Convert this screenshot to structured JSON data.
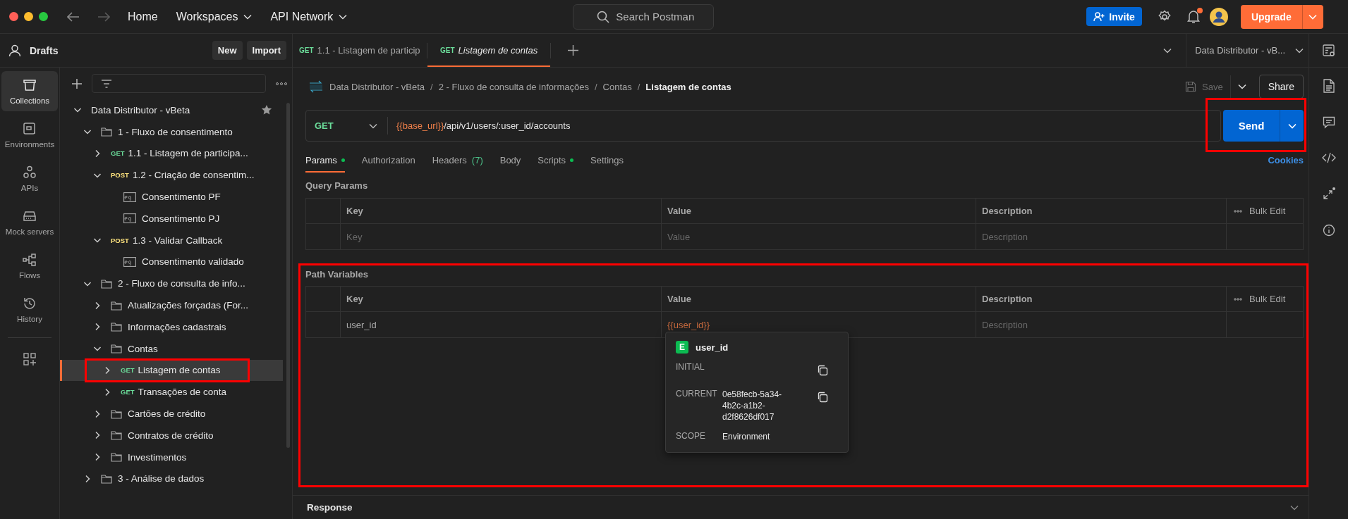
{
  "app_bar": {
    "nav": [
      {
        "label": "Home",
        "dropdown": false
      },
      {
        "label": "Workspaces",
        "dropdown": true
      },
      {
        "label": "API Network",
        "dropdown": true
      }
    ],
    "search": {
      "placeholder": "Search Postman"
    },
    "invite": "Invite",
    "notifications_unread": true,
    "upgrade": "Upgrade"
  },
  "workspace": {
    "title": "Drafts",
    "buttons": [
      "New",
      "Import"
    ]
  },
  "rail": [
    {
      "label": "Collections",
      "kind": "collections",
      "selected": true
    },
    {
      "label": "Environments",
      "kind": "environments",
      "selected": false
    },
    {
      "label": "APIs",
      "kind": "apis",
      "selected": false
    },
    {
      "label": "Mock servers",
      "kind": "mock",
      "selected": false
    },
    {
      "label": "Flows",
      "kind": "flows",
      "selected": false
    },
    {
      "label": "History",
      "kind": "history",
      "selected": false
    }
  ],
  "tree": [
    {
      "kind": "collection",
      "label": "Data Distributor - vBeta",
      "expanded": true,
      "starred": true,
      "selected": false,
      "highlighted": false,
      "children": [
        {
          "kind": "folder",
          "label": "1 - Fluxo de consentimento",
          "expanded": true,
          "selected": false,
          "highlighted": false,
          "children": [
            {
              "kind": "request",
              "method": "GET",
              "color": "#6bdd9a",
              "label": "1.1 - Listagem de participa...",
              "expanded": false,
              "selected": false,
              "highlighted": false
            },
            {
              "kind": "request",
              "method": "POST",
              "color": "#ffe47e",
              "label": "1.2 - Criação de consentim...",
              "expanded": true,
              "selected": false,
              "highlighted": false,
              "children": [
                {
                  "kind": "example",
                  "label": "Consentimento PF",
                  "selected": false,
                  "highlighted": false
                },
                {
                  "kind": "example",
                  "label": "Consentimento PJ",
                  "selected": false,
                  "highlighted": false
                }
              ]
            },
            {
              "kind": "request",
              "method": "POST",
              "color": "#ffe47e",
              "label": "1.3 - Validar Callback",
              "expanded": true,
              "selected": false,
              "highlighted": false,
              "children": [
                {
                  "kind": "example",
                  "label": "Consentimento validado",
                  "selected": false,
                  "highlighted": false
                }
              ]
            }
          ]
        },
        {
          "kind": "folder",
          "label": "2 - Fluxo de consulta de info...",
          "expanded": true,
          "selected": false,
          "highlighted": false,
          "children": [
            {
              "kind": "folder",
              "label": "Atualizações forçadas (For...",
              "expanded": false,
              "selected": false,
              "highlighted": false
            },
            {
              "kind": "folder",
              "label": "Informações cadastrais",
              "expanded": false,
              "selected": false,
              "highlighted": false
            },
            {
              "kind": "folder",
              "label": "Contas",
              "expanded": true,
              "selected": false,
              "highlighted": false,
              "children": [
                {
                  "kind": "request",
                  "method": "GET",
                  "color": "#6bdd9a",
                  "label": "Listagem de contas",
                  "expanded": false,
                  "selected": true,
                  "highlighted": true
                },
                {
                  "kind": "request",
                  "method": "GET",
                  "color": "#6bdd9a",
                  "label": "Transações de conta",
                  "expanded": false,
                  "selected": false,
                  "highlighted": false
                }
              ]
            },
            {
              "kind": "folder",
              "label": "Cartões de crédito",
              "expanded": false,
              "selected": false,
              "highlighted": false
            },
            {
              "kind": "folder",
              "label": "Contratos de crédito",
              "expanded": false,
              "selected": false,
              "highlighted": false
            },
            {
              "kind": "folder",
              "label": "Investimentos",
              "expanded": false,
              "selected": false,
              "highlighted": false
            }
          ]
        },
        {
          "kind": "folder",
          "label": "3 - Análise de dados",
          "expanded": false,
          "selected": false,
          "highlighted": false
        }
      ]
    }
  ],
  "tabs": [
    {
      "method": "GET",
      "color": "#6bdd9a",
      "label": "1.1 - Listagem de particip",
      "selected": false,
      "preview": false
    },
    {
      "method": "GET",
      "color": "#6bdd9a",
      "label": "Listagem de contas",
      "selected": true,
      "preview": true
    }
  ],
  "environment": "Data Distributor - vB...",
  "breadcrumb": {
    "separator": "/",
    "items": [
      "Data Distributor - vBeta",
      "2 - Fluxo de consulta de informações",
      "Contas",
      "Listagem de contas"
    ]
  },
  "save": {
    "label": "Save",
    "disabled": true
  },
  "share": "Share",
  "request": {
    "method": {
      "label": "GET",
      "color": "#6bdd9a"
    },
    "url": [
      {
        "kind": "variable",
        "text": "{{base_url}}"
      },
      {
        "kind": "path",
        "text": "/api/v1/users/:user_id/accounts"
      }
    ],
    "send": "Send",
    "send_highlighted": true
  },
  "request_tabs": [
    {
      "label": "Params",
      "selected": true,
      "dot": true
    },
    {
      "label": "Authorization",
      "selected": false,
      "dot": false
    },
    {
      "label": "Headers",
      "count": "(7)",
      "selected": false,
      "dot": false
    },
    {
      "label": "Body",
      "selected": false,
      "dot": false
    },
    {
      "label": "Scripts",
      "selected": false,
      "dot": true
    },
    {
      "label": "Settings",
      "selected": false,
      "dot": false
    }
  ],
  "cookies": "Cookies",
  "query_params": {
    "title": "Query Params",
    "columns": [
      "Key",
      "Value",
      "Description"
    ],
    "bulk_edit": "Bulk Edit",
    "rows": [
      {
        "key_placeholder": "Key",
        "value_placeholder": "Value",
        "description_placeholder": "Description"
      }
    ]
  },
  "path_variables": {
    "title": "Path Variables",
    "highlighted": true,
    "columns": [
      "Key",
      "Value",
      "Description"
    ],
    "bulk_edit": "Bulk Edit",
    "rows": [
      {
        "key": "user_id",
        "value": "{{user_id}}",
        "description_placeholder": "Description"
      }
    ]
  },
  "variable_popup": {
    "badge": "E",
    "name": "user_id",
    "fields": [
      {
        "label": "INITIAL",
        "copyable": true
      },
      {
        "label": "CURRENT",
        "value": "0e58fecb-5a34-4b2c-a1b2-d2f8626df017",
        "copyable": true
      },
      {
        "label": "SCOPE",
        "value": "Environment",
        "copyable": false
      }
    ]
  },
  "response": {
    "title": "Response"
  }
}
